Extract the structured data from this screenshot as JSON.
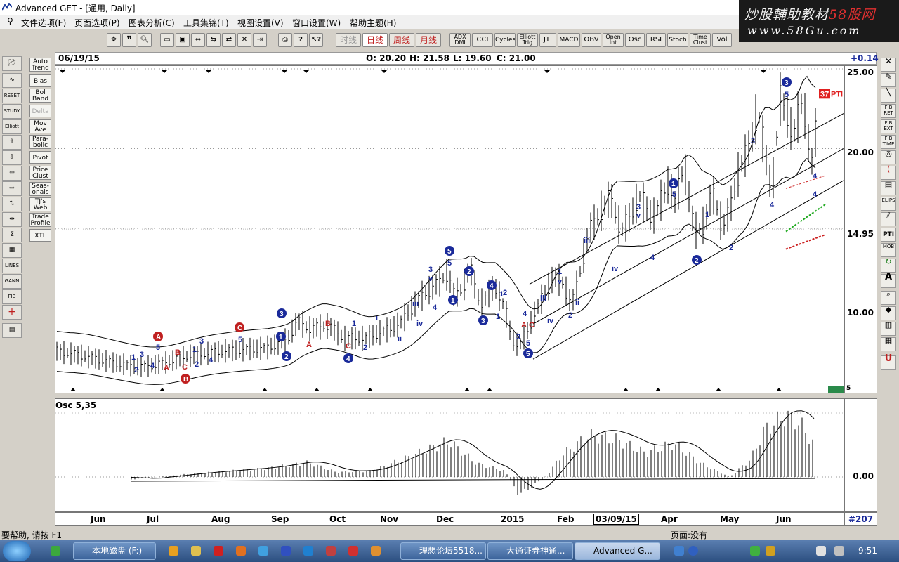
{
  "window": {
    "title": "Advanced GET - [通用, Daily]"
  },
  "watermark": {
    "line1_a": "炒股輔助教材",
    "line1_b": "58股网",
    "line2": "www.58Gu.com"
  },
  "menu": [
    "文件选项(F)",
    "页面选项(P)",
    "图表分析(C)",
    "工具集锦(T)",
    "视图设置(V)",
    "窗口设置(W)",
    "帮助主题(H)"
  ],
  "toolbar": {
    "periods": [
      "时线",
      "日线",
      "周线",
      "月线"
    ],
    "studies": [
      "ADX DMI",
      "CCI",
      "Cycles",
      "Elliott Trig",
      "JTI",
      "MACD",
      "OBV",
      "Open Int",
      "Osc",
      "RSI",
      "Stoch",
      "Time Clust",
      "Vol"
    ]
  },
  "infobar": {
    "date": "06/19/15",
    "open": "O: 20.20",
    "high": "H: 21.58",
    "low": "L: 19.60",
    "close": "C: 21.00",
    "change": "+0.14"
  },
  "left_studies": [
    "Auto Trend",
    "Bias",
    "Bol Band",
    "Delta",
    "Mov Ave",
    "Para- bolic",
    "Pivot",
    "Price Clust",
    "Seas- onals",
    "TJ's Web",
    "Trade Profile",
    "XTL"
  ],
  "left_tools": [
    "RESET",
    "STUDY",
    "Elliott",
    "LINES",
    "GANN",
    "FIB"
  ],
  "right_tools": [
    "FIB RET",
    "FIB EXT",
    "FIB TIME",
    "PTI",
    "MOB",
    "ELIPS"
  ],
  "price_axis": {
    "ticks": [
      "25.00",
      "20.00",
      "14.95",
      "10.00",
      "5"
    ],
    "current": "14.95"
  },
  "pti": {
    "value": "37",
    "label": "PTI"
  },
  "osc": {
    "title": "Osc 5,35",
    "zero": "0.00"
  },
  "date_axis": {
    "labels": [
      "Jun",
      "Jul",
      "Aug",
      "Sep",
      "Oct",
      "Nov",
      "Dec",
      "2015",
      "Feb",
      "03/09/15",
      "Apr",
      "May",
      "Jun"
    ]
  },
  "bar_count": "#207",
  "status": {
    "help": "要帮助, 请按 F1",
    "page": "页面:没有"
  },
  "taskbar": {
    "tasks": [
      "本地磁盘 (F:)",
      "理想论坛5518...",
      "大通证券神通...",
      "Advanced G..."
    ],
    "clock": "9:51"
  },
  "elliott_labels": {
    "blue": [
      "1",
      "2",
      "3",
      "4",
      "5",
      "1",
      "2",
      "3",
      "4",
      "5",
      "1",
      "2",
      "3",
      "4",
      "5",
      "1",
      "2",
      "3",
      "4",
      "5",
      "i",
      "ii",
      "iii",
      "iv",
      "v",
      "i",
      "ii",
      "iii",
      "iv",
      "v"
    ],
    "red": [
      "A",
      "B",
      "C",
      "A",
      "B",
      "C",
      "A",
      "B",
      "C"
    ]
  },
  "colors": {
    "accent_blue": "#1a2a9a",
    "red": "#c02020",
    "pti_red": "#e02020",
    "bg": "#d4d0c8"
  }
}
